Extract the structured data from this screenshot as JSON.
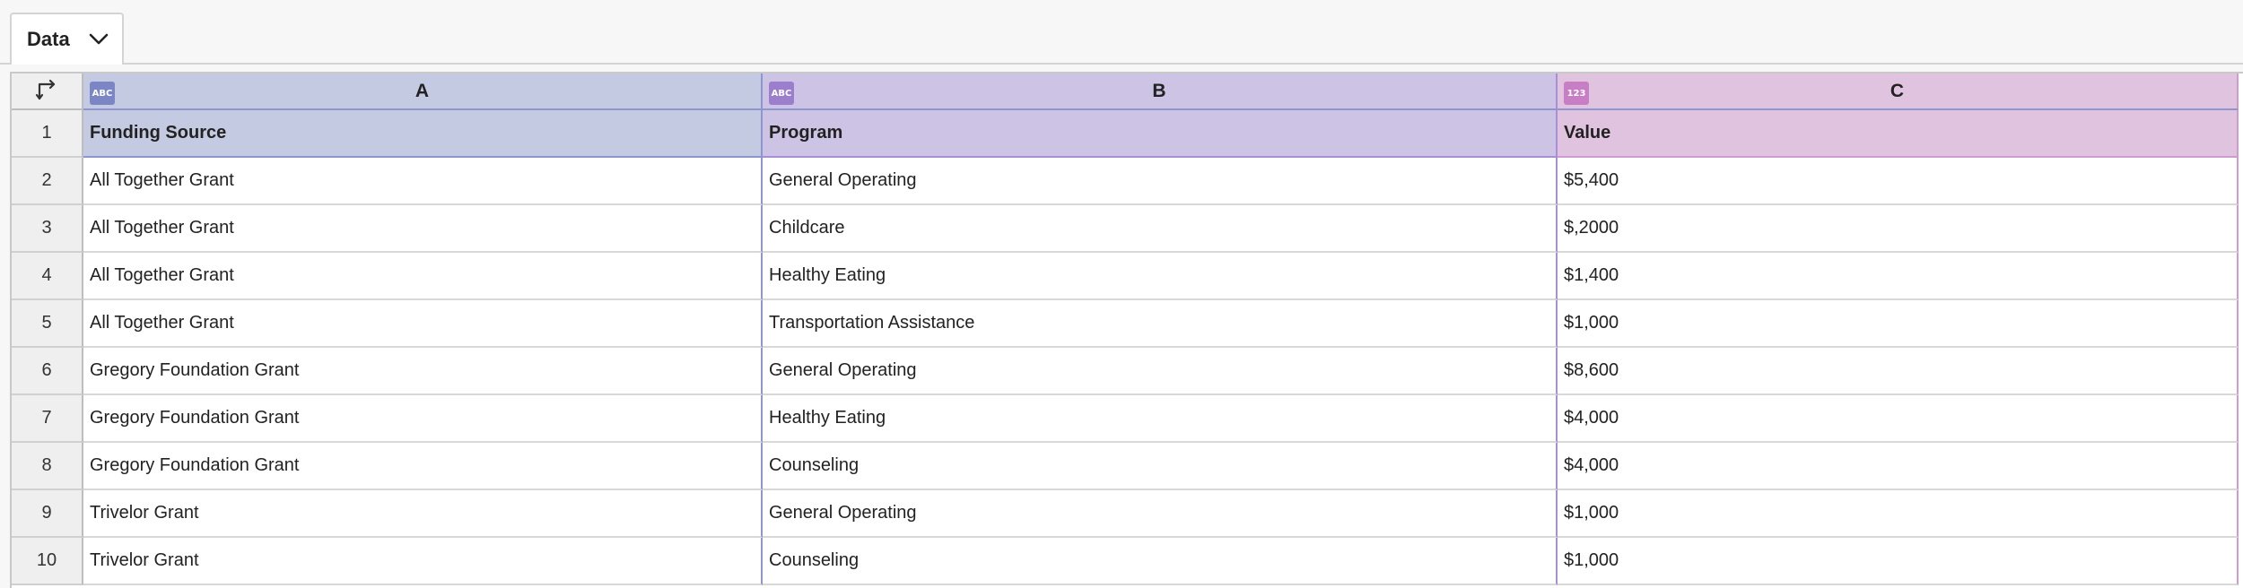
{
  "tab": {
    "label": "Data"
  },
  "colors": {
    "colA": "#c3cae2",
    "colB": "#cdc3e4",
    "colC": "#e0c4df",
    "badgeA": "#7d86c4",
    "badgeB": "#9b7fcc",
    "badgeC": "#c77ec4"
  },
  "icons": {
    "corner": "transpose-arrows-icon",
    "tab": "chevron-down-icon"
  },
  "columns": [
    {
      "letter": "A",
      "type_badge": "ABC"
    },
    {
      "letter": "B",
      "type_badge": "ABC"
    },
    {
      "letter": "C",
      "type_badge": "123"
    }
  ],
  "row_numbers": [
    "1",
    "2",
    "3",
    "4",
    "5",
    "6",
    "7",
    "8",
    "9",
    "10"
  ],
  "header_row": [
    "Funding Source",
    "Program",
    "Value"
  ],
  "rows": [
    [
      "All Together Grant",
      "General Operating",
      "$5,400"
    ],
    [
      "All Together Grant",
      "Childcare",
      "$,2000"
    ],
    [
      "All Together Grant",
      "Healthy Eating",
      "$1,400"
    ],
    [
      "All Together Grant",
      "Transportation Assistance",
      "$1,000"
    ],
    [
      "Gregory Foundation Grant",
      "General Operating",
      "$8,600"
    ],
    [
      "Gregory Foundation Grant",
      "Healthy Eating",
      "$4,000"
    ],
    [
      "Gregory Foundation Grant",
      "Counseling",
      "$4,000"
    ],
    [
      "Trivelor Grant",
      "General Operating",
      "$1,000"
    ],
    [
      "Trivelor Grant",
      "Counseling",
      "$1,000"
    ]
  ]
}
